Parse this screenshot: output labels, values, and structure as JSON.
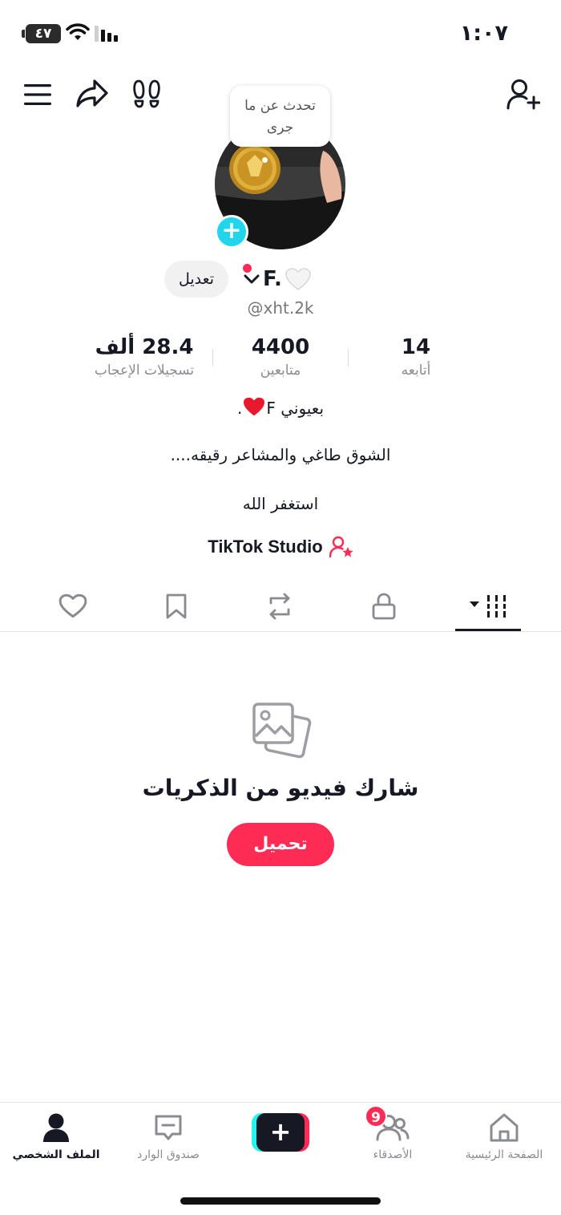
{
  "status_bar": {
    "time": "١:٠٧",
    "battery": "٤٧"
  },
  "profile": {
    "speech_bubble": "تحدث عن ما جرى",
    "edit_label": "تعديل",
    "display_name": "F.",
    "username": "@xht.2k"
  },
  "stats": {
    "likes": {
      "value": "28.4 ألف",
      "label": "تسجيلات الإعجاب"
    },
    "followers": {
      "value": "4400",
      "label": "متابعين"
    },
    "following": {
      "value": "14",
      "label": "أتابعه"
    }
  },
  "bio": {
    "line1_text": "بعيوني F",
    "line1_suffix": ".",
    "line2": "الشوق طاغي والمشاعر رقيقه....",
    "line3": "استغفر الله"
  },
  "studio": {
    "label": "TikTok Studio"
  },
  "tabs": [
    "likes-tab",
    "favorites-tab",
    "reposts-tab",
    "private-tab",
    "videos-tab"
  ],
  "empty_state": {
    "title": "شارك فيديو من الذكريات",
    "button": "تحميل"
  },
  "bottom_nav": {
    "profile": "الملف الشخصي",
    "inbox": "صندوق الوارد",
    "friends": "الأصدقاء",
    "friends_badge": "9",
    "home": "الصفحة الرئيسية"
  },
  "colors": {
    "accent": "#fe2c55",
    "cyan": "#25f4ee",
    "avatar_plus": "#20d5ec",
    "text": "#161823",
    "muted": "#8a8b91"
  }
}
